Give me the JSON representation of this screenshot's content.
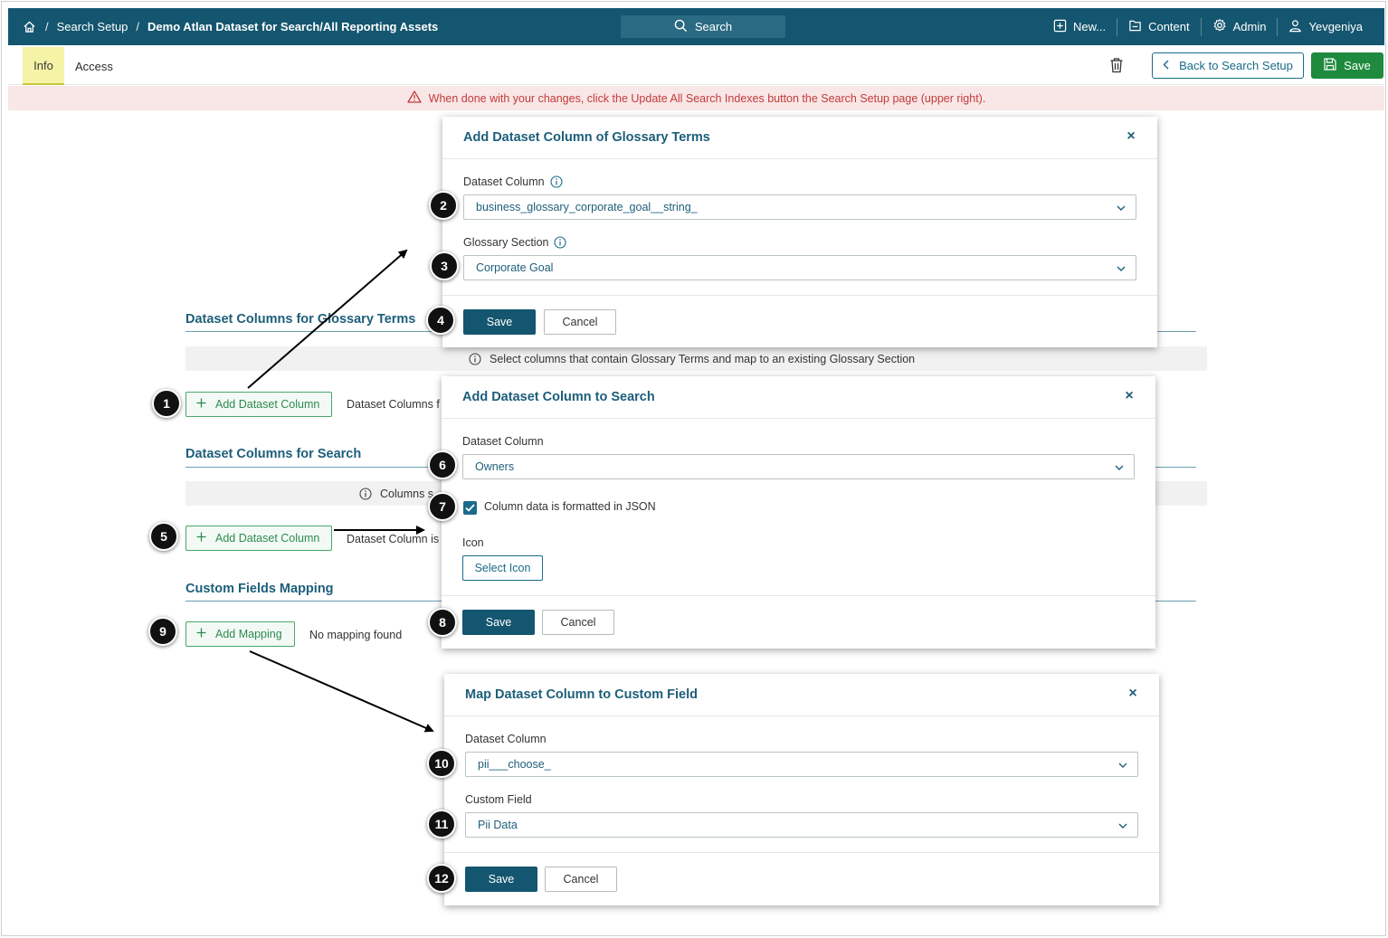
{
  "topbar": {
    "breadcrumbs": [
      "Search Setup",
      "Demo Atlan Dataset for Search/All Reporting Assets"
    ],
    "search_label": "Search",
    "nav": {
      "new": "New...",
      "content": "Content",
      "admin": "Admin",
      "user": "Yevgeniya"
    }
  },
  "tabs": {
    "info": "Info",
    "access": "Access"
  },
  "actions": {
    "back": "Back to Search Setup",
    "save": "Save"
  },
  "alert": "When done with your changes, click the Update All Search Indexes button the Search Setup page (upper right).",
  "sections": {
    "glossary": {
      "title": "Dataset Columns for Glossary Terms",
      "info": "Select columns that contain Glossary Terms and map to an existing Glossary Section",
      "add_button": "Add Dataset Column",
      "status": "Dataset Columns f"
    },
    "search": {
      "title": "Dataset Columns for Search",
      "info": "Columns s",
      "add_button": "Add Dataset Column",
      "status": "Dataset Column is"
    },
    "custom": {
      "title": "Custom Fields Mapping",
      "add_button": "Add Mapping",
      "status": "No mapping found"
    }
  },
  "modal_glossary": {
    "title": "Add Dataset Column of Glossary Terms",
    "column_label": "Dataset Column",
    "column_value": "business_glossary_corporate_goal__string_",
    "section_label": "Glossary Section",
    "section_value": "Corporate Goal",
    "save": "Save",
    "cancel": "Cancel"
  },
  "modal_search": {
    "title": "Add Dataset Column to Search",
    "column_label": "Dataset Column",
    "column_value": "Owners",
    "json_checkbox_label": "Column data is formatted in JSON",
    "json_checked": true,
    "icon_label": "Icon",
    "select_icon": "Select Icon",
    "save": "Save",
    "cancel": "Cancel"
  },
  "modal_custom": {
    "title": "Map Dataset Column to Custom Field",
    "column_label": "Dataset Column",
    "column_value": "pii___choose_",
    "field_label": "Custom Field",
    "field_value": "Pii Data",
    "save": "Save",
    "cancel": "Cancel"
  },
  "steps": [
    "1",
    "2",
    "3",
    "4",
    "5",
    "6",
    "7",
    "8",
    "9",
    "10",
    "11",
    "12"
  ],
  "colors": {
    "brand": "#14566f",
    "accent_green": "#1e8a3e",
    "alert_text": "#c33b3b"
  }
}
